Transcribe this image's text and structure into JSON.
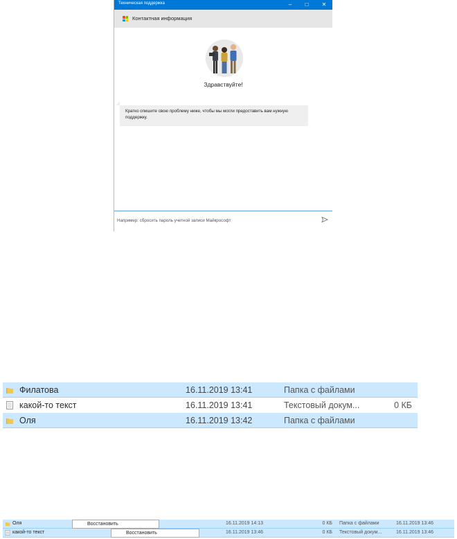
{
  "support_window": {
    "title": "Техническая поддержка",
    "controls": {
      "minimize": "–",
      "maximize": "□",
      "close": "✕"
    },
    "header_label": "Контактная информация",
    "greeting": "Здравствуйте!",
    "message": "Кратко опишите свою проблему ниже, чтобы мы могли предоставить вам нужную поддержку.",
    "input_placeholder": "Например: сбросить пароль учетной записи Майкрософт",
    "colors": {
      "titlebar": "#0078d7",
      "header": "#e6e6e6",
      "bubble": "#efefef"
    }
  },
  "explorer_big": {
    "rows": [
      {
        "icon": "folder-icon",
        "name": "Филатова",
        "date": "16.11.2019 13:41",
        "type": "Папка с файлами",
        "size": "",
        "selected": true
      },
      {
        "icon": "text-file-icon",
        "name": "какой-то текст",
        "date": "16.11.2019 13:41",
        "type": "Текстовый докум...",
        "size": "0 КБ",
        "selected": false
      },
      {
        "icon": "folder-icon",
        "name": "Оля",
        "date": "16.11.2019 13:42",
        "type": "Папка с файлами",
        "size": "",
        "selected": true
      }
    ]
  },
  "explorer_small": {
    "rows": [
      {
        "icon": "folder-icon",
        "name": "Оля",
        "date": "16.11.2019 14:13",
        "size": "0 КБ",
        "type": "Папка с файлами",
        "date2": "16.11.2019 13:46"
      },
      {
        "icon": "text-file-icon",
        "name": "какой-то текст",
        "date": "16.11.2019 13:46",
        "size": "0 КБ",
        "type": "Текстовый докум...",
        "date2": "16.11.2019 13:46"
      }
    ],
    "restore_label_1": "Восстановить",
    "restore_label_2": "Восстановить",
    "colors": {
      "selection": "#cce8ff",
      "selection_border": "#99d1ff"
    }
  }
}
